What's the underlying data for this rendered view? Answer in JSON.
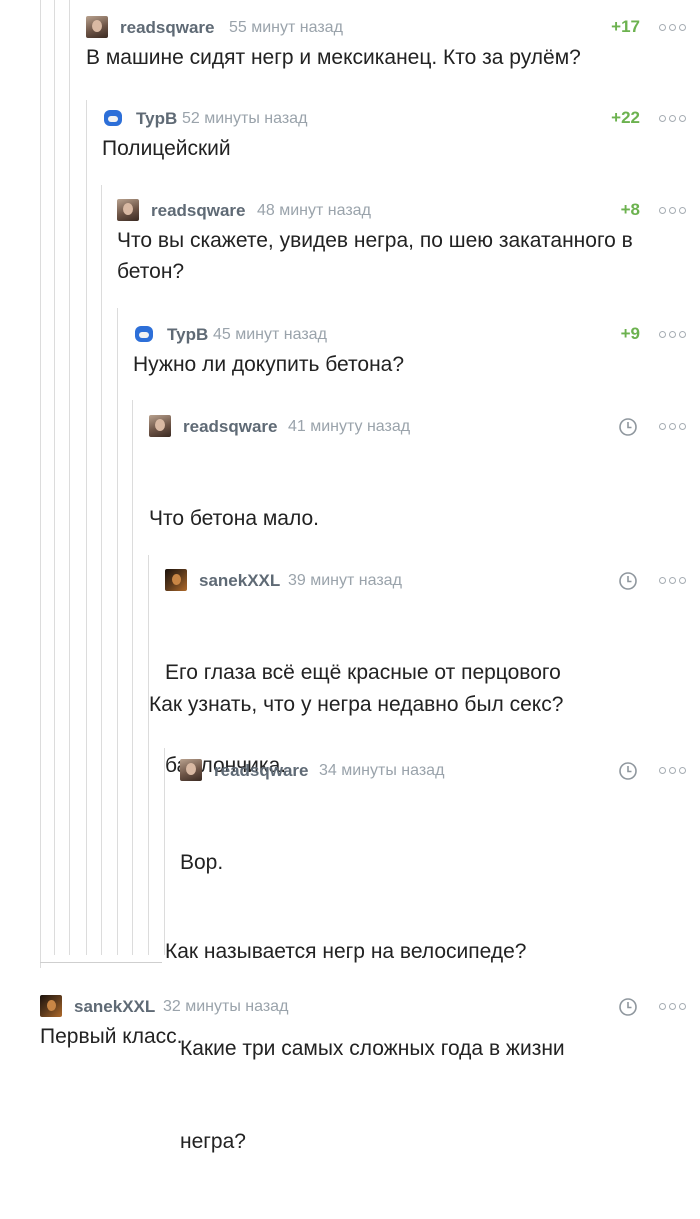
{
  "comments": [
    {
      "author": "readsqware",
      "avatar": "portrait-woman",
      "time": "55 минут назад",
      "rating": "+17",
      "text": "В машине сидят негр и мексиканец. Кто за рулём?"
    },
    {
      "author": "TypB",
      "avatar": "blue-cartoon-character",
      "time": "52 минуты назад",
      "rating": "+22",
      "text": "Полицейский"
    },
    {
      "author": "readsqware",
      "avatar": "portrait-woman",
      "time": "48 минут назад",
      "rating": "+8",
      "text": "Что вы скажете, увидев негра, по шею закатанного в бетон?"
    },
    {
      "author": "TypB",
      "avatar": "blue-cartoon-character",
      "time": "45 минут назад",
      "rating": "+9",
      "text": "Нужно ли докупить бетона?"
    },
    {
      "author": "readsqware",
      "avatar": "portrait-woman",
      "time": "41 минуту назад",
      "rating_icon": "clock-icon",
      "text_lines": [
        "Что бетона мало.",
        "",
        "Как узнать, что у негра недавно был секс?"
      ]
    },
    {
      "author": "sanekXXL",
      "avatar": "dark-portrait",
      "time": "39 минут назад",
      "rating_icon": "clock-icon",
      "text_lines": [
        "Его глаза всё ещё красные от перцового",
        "баллончика.",
        "",
        "Как называется негр на велосипеде?"
      ]
    },
    {
      "author": "readsqware",
      "avatar": "portrait-woman",
      "time": "34 минуты назад",
      "rating_icon": "clock-icon",
      "text_lines": [
        "Вор.",
        "",
        "Какие три самых сложных года в жизни",
        "негра?"
      ]
    },
    {
      "author": "sanekXXL",
      "avatar": "dark-portrait",
      "time": "32 минуты назад",
      "rating_icon": "clock-icon",
      "text": "Первый класс."
    }
  ],
  "colors": {
    "rating_positive": "#6cb24f",
    "author": "#5f6a75",
    "time": "#9aa3ab",
    "thread_line": "#dcdcdc"
  }
}
